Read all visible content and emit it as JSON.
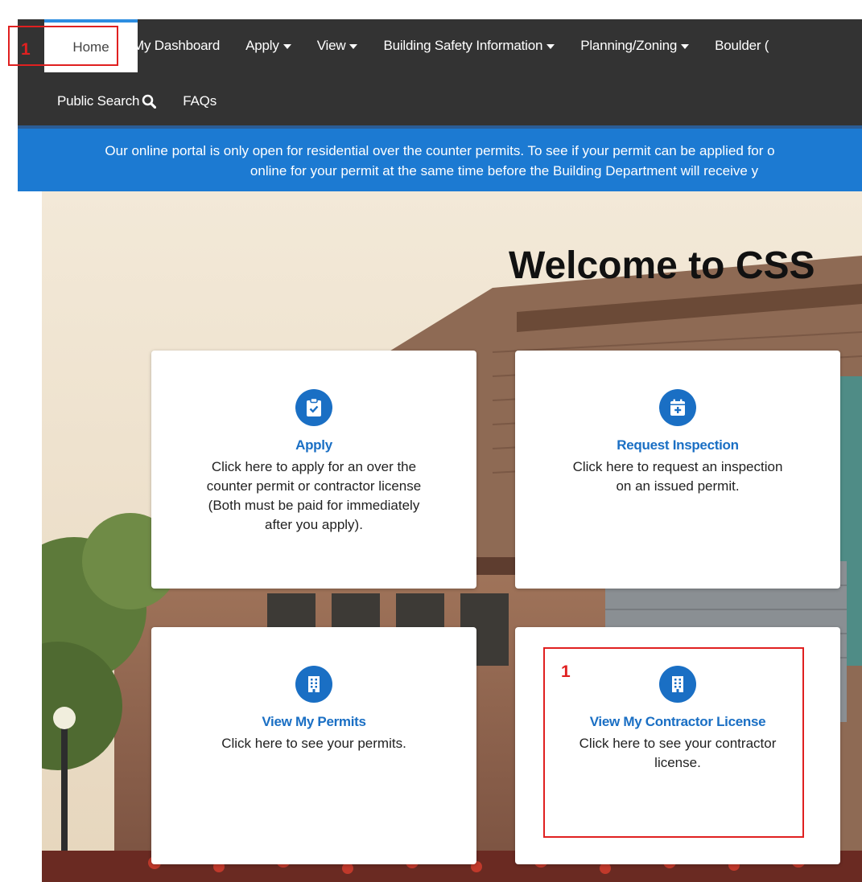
{
  "nav": {
    "home": "Home",
    "items": [
      {
        "label": "My Dashboard",
        "caret": false
      },
      {
        "label": "Apply",
        "caret": true
      },
      {
        "label": "View",
        "caret": true
      },
      {
        "label": "Building Safety Information",
        "caret": true
      },
      {
        "label": "Planning/Zoning",
        "caret": true
      },
      {
        "label": "Boulder (",
        "caret": false
      }
    ],
    "row2": {
      "public_search": "Public Search",
      "faqs": "FAQs"
    }
  },
  "banner": {
    "line1": "Our online portal is only open for residential over the counter permits. To see if your permit can be applied for o",
    "line2": "online for your permit at the same time before the Building Department will receive y"
  },
  "hero": {
    "welcome": "Welcome to CSS"
  },
  "cards": {
    "apply": {
      "icon": "clipboard-check-icon",
      "title": "Apply",
      "desc1": "Click here to apply for an over the",
      "desc2": "counter permit or contractor license",
      "desc3": "(Both must be paid for immediately",
      "desc4": "after you apply)."
    },
    "inspection": {
      "icon": "calendar-plus-icon",
      "title": "Request Inspection",
      "desc1": "Click here to request an inspection",
      "desc2": "on an issued permit."
    },
    "permits": {
      "icon": "building-icon",
      "title": "View My Permits",
      "desc1": "Click here to see your permits."
    },
    "license": {
      "icon": "building-icon",
      "title": "View My Contractor License",
      "desc1": "Click here to see your contractor",
      "desc2": "license."
    }
  },
  "annotations": {
    "nav_marker": "1",
    "card_marker": "1"
  },
  "colors": {
    "navbar": "#333333",
    "banner": "#1c7ad2",
    "accent": "#1a6fc4",
    "annotation": "#e02020"
  }
}
